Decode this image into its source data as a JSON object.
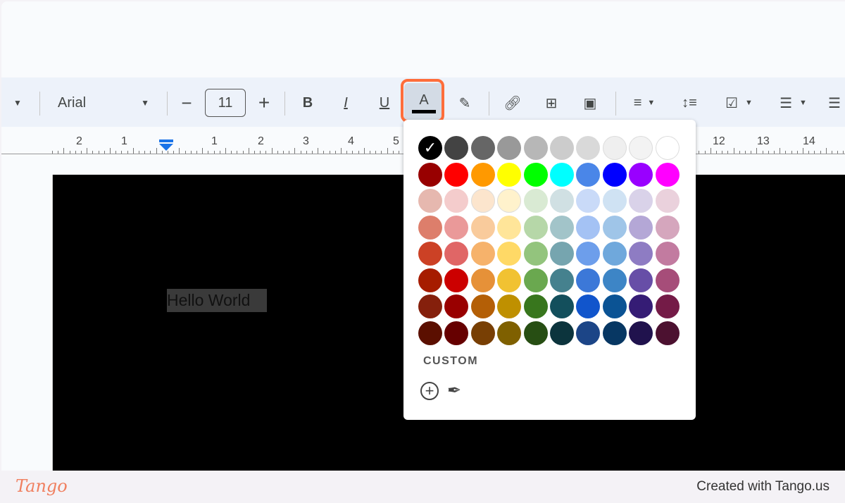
{
  "toolbar": {
    "font": "Arial",
    "font_size": "11",
    "bold": "B",
    "italic": "I",
    "underline": "U",
    "text_color": "A",
    "selected_text_color": "#000000",
    "highlight_color": "#ff6d3a"
  },
  "ruler": {
    "numbers": [
      "2",
      "1",
      "1",
      "2",
      "3",
      "4",
      "5",
      "12",
      "13",
      "14"
    ]
  },
  "document": {
    "text": "Hello World"
  },
  "palette": {
    "rows": [
      [
        "#000000",
        "#434343",
        "#666666",
        "#999999",
        "#b7b7b7",
        "#cccccc",
        "#d9d9d9",
        "#efefef",
        "#f3f3f3",
        "#ffffff"
      ],
      [
        "#980000",
        "#ff0000",
        "#ff9900",
        "#ffff00",
        "#00ff00",
        "#00ffff",
        "#4a86e8",
        "#0000ff",
        "#9900ff",
        "#ff00ff"
      ],
      [
        "#e6b8af",
        "#f4cccc",
        "#fce5cd",
        "#fff2cc",
        "#d9ead3",
        "#d0e0e3",
        "#c9daf8",
        "#cfe2f3",
        "#d9d2e9",
        "#ead1dc"
      ],
      [
        "#dd7e6b",
        "#ea9999",
        "#f9cb9c",
        "#ffe599",
        "#b6d7a8",
        "#a2c4c9",
        "#a4c2f4",
        "#9fc5e8",
        "#b4a7d6",
        "#d5a6bd"
      ],
      [
        "#cc4125",
        "#e06666",
        "#f6b26b",
        "#ffd966",
        "#93c47d",
        "#76a5af",
        "#6d9eeb",
        "#6fa8dc",
        "#8e7cc3",
        "#c27ba0"
      ],
      [
        "#a61c00",
        "#cc0000",
        "#e69138",
        "#f1c232",
        "#6aa84f",
        "#45818e",
        "#3c78d8",
        "#3d85c6",
        "#674ea7",
        "#a64d79"
      ],
      [
        "#85200c",
        "#990000",
        "#b45f06",
        "#bf9000",
        "#38761d",
        "#134f5c",
        "#1155cc",
        "#0b5394",
        "#351c75",
        "#741b47"
      ],
      [
        "#5b0f00",
        "#660000",
        "#783f04",
        "#7f6000",
        "#274e13",
        "#0c343d",
        "#1c4587",
        "#073763",
        "#20124d",
        "#4c1130"
      ]
    ],
    "custom_label": "CUSTOM"
  },
  "footer": {
    "logo": "Tango",
    "credit": "Created with Tango.us"
  }
}
